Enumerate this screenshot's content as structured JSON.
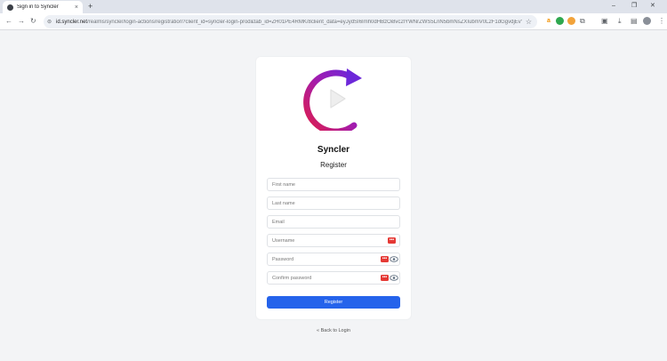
{
  "browser": {
    "tab_title": "Sign in to Syncler",
    "tab_close": "×",
    "new_tab": "+",
    "window_controls": {
      "minimize": "–",
      "maximize": "❐",
      "close": "✕"
    },
    "nav": {
      "back": "←",
      "forward": "→",
      "reload": "↻"
    },
    "url_host": "id.syncler.net",
    "url_rest": "/realms/syncler/login-actions/registration?client_id=syncler-login-prod&tab_id=ZH01PE4RMK/8client_data=eyJydSI6Imh0dHBzOi8vc2lYWNrZWS5LnN5bmNsZXIubmV0L2F1dGgvdjEvY2FsbGJhY2s&Cjyd...",
    "icons": [
      "site-info-icon",
      "star-icon",
      "amazon-extension-icon",
      "green-extension-icon",
      "orange-extension-icon",
      "puzzle-extension-icon",
      "sidebar-icon",
      "download-icon",
      "bookmarks-icon",
      "profile-avatar",
      "menu-icon"
    ]
  },
  "card": {
    "app_name": "Syncler",
    "form_title": "Register",
    "fields": {
      "first_name": {
        "placeholder": "First name"
      },
      "last_name": {
        "placeholder": "Last name"
      },
      "email": {
        "placeholder": "Email"
      },
      "username": {
        "placeholder": "Username"
      },
      "password": {
        "placeholder": "Password"
      },
      "confirm_password": {
        "placeholder": "Confirm password"
      }
    },
    "password_manager_badge": "•••",
    "register_button": "Register",
    "back_link": "« Back to Login"
  },
  "colors": {
    "accent": "#2563eb",
    "logo_gradient_start": "#e11d48",
    "logo_gradient_end": "#6d28d9",
    "password_badge": "#e53935",
    "background": "#f3f4f6"
  }
}
